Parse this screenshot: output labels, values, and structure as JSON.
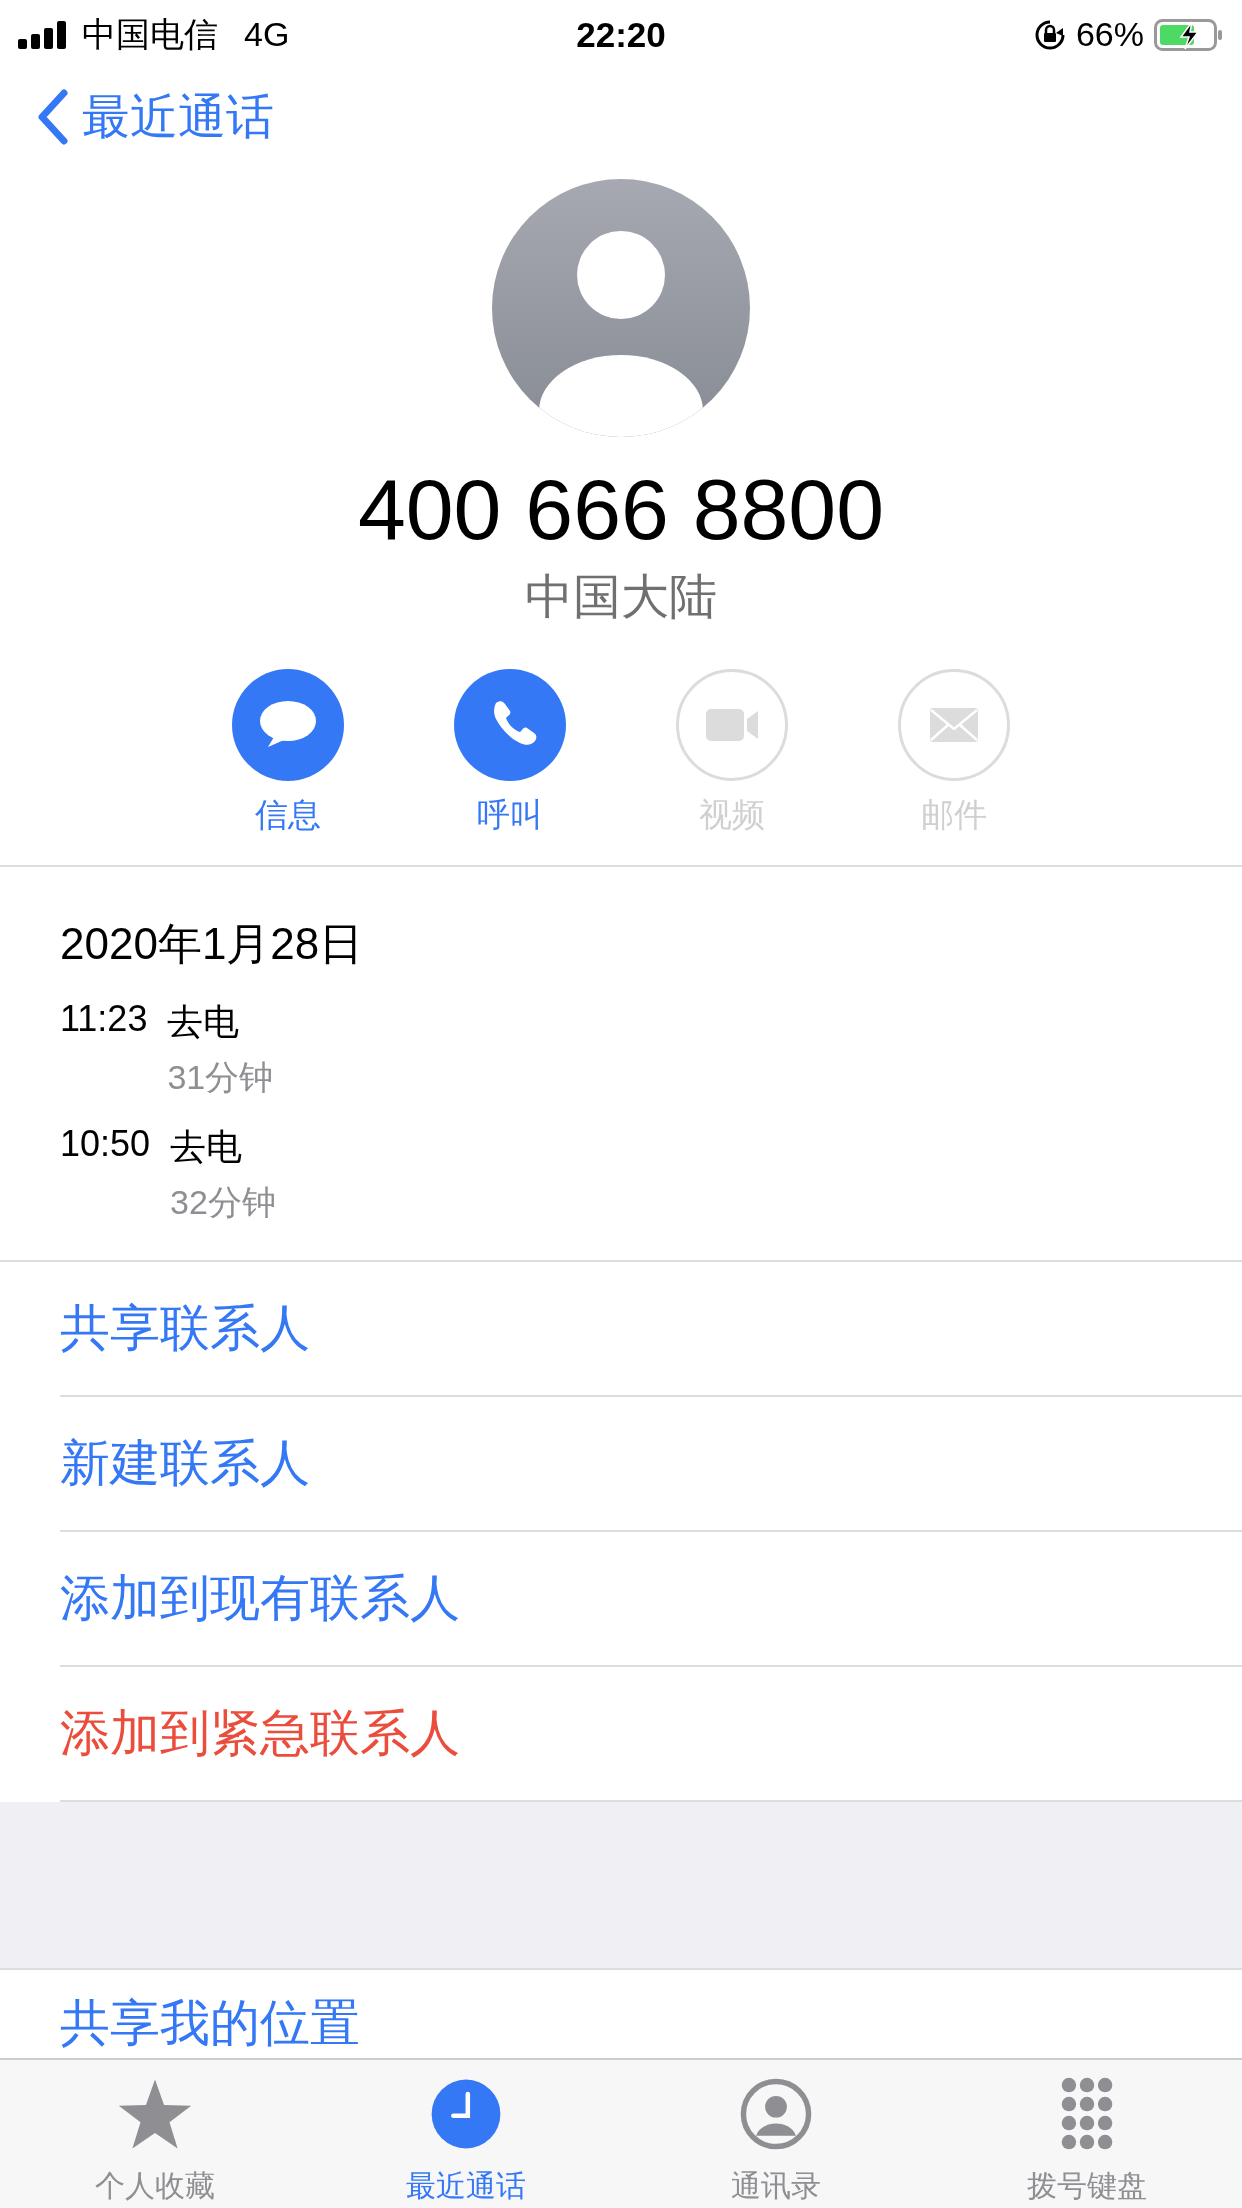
{
  "status_bar": {
    "carrier": "中国电信",
    "network": "4G",
    "time": "22:20",
    "battery": "66%"
  },
  "nav": {
    "back_label": "最近通话"
  },
  "contact": {
    "number": "400 666 8800",
    "region": "中国大陆"
  },
  "actions": [
    {
      "kind": "message",
      "label": "信息",
      "disabled": false
    },
    {
      "kind": "phone",
      "label": "呼叫",
      "disabled": false
    },
    {
      "kind": "video",
      "label": "视频",
      "disabled": true
    },
    {
      "kind": "mail",
      "label": "邮件",
      "disabled": true
    }
  ],
  "history": {
    "date": "2020年1月28日",
    "calls": [
      {
        "time": "11:23",
        "type": "去电",
        "duration": "31分钟"
      },
      {
        "time": "10:50",
        "type": "去电",
        "duration": "32分钟"
      }
    ]
  },
  "menu": [
    {
      "label": "共享联系人",
      "destructive": false
    },
    {
      "label": "新建联系人",
      "destructive": false
    },
    {
      "label": "添加到现有联系人",
      "destructive": false
    },
    {
      "label": "添加到紧急联系人",
      "destructive": true
    }
  ],
  "share_location": {
    "label": "共享我的位置"
  },
  "tabs": [
    {
      "kind": "favorites",
      "label": "个人收藏",
      "selected": false
    },
    {
      "kind": "recents",
      "label": "最近通话",
      "selected": true
    },
    {
      "kind": "contacts",
      "label": "通讯录",
      "selected": false
    },
    {
      "kind": "keypad",
      "label": "拨号键盘",
      "selected": false
    }
  ]
}
